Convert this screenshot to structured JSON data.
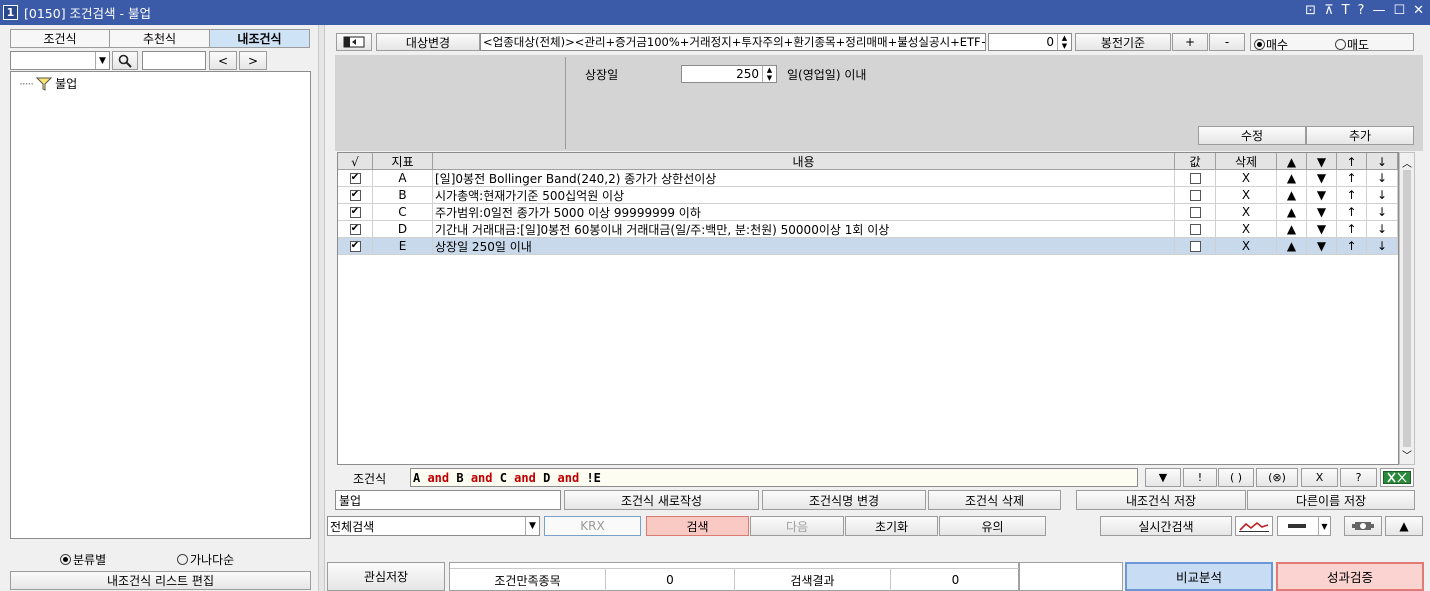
{
  "window": {
    "num": "1",
    "title": "[0150] 조건검색 - 불업",
    "controls": [
      "⊡",
      "⊼",
      "T",
      "?",
      "—",
      "☐",
      "✕"
    ]
  },
  "left": {
    "tabs": [
      "조건식",
      "추천식",
      "내조건식"
    ],
    "prev": "<",
    "next": ">",
    "tree_node": "불업",
    "radio1": "분류별",
    "radio2": "가나다순",
    "edit_list": "내조건식 리스트 편집"
  },
  "top": {
    "target_change": "대상변경",
    "target_text": "<업종대상(전체)><관리+증거금100%+거래정지+투자주의+환기종목+정리매매+불성실공시+ETF+",
    "num_value": "0",
    "bong": "봉전기준",
    "plus": "+",
    "minus": "-",
    "buy": "매수",
    "sell": "매도"
  },
  "cond": {
    "label": "상장일",
    "value": "250",
    "suffix": "일(영업일) 이내",
    "edit": "수정",
    "add": "추가"
  },
  "grid": {
    "headers": [
      "√",
      "지표",
      "내용",
      "값",
      "삭제",
      "▲",
      "▼",
      "↑",
      "↓"
    ],
    "rows": [
      {
        "id": "A",
        "content": "[일]0봉전 Bollinger Band(240,2) 종가가 상한선이상",
        "del": "X",
        "checked": true,
        "val_checked": false
      },
      {
        "id": "B",
        "content": "시가총액:현재가기준 500십억원 이상",
        "del": "X",
        "checked": true,
        "val_checked": false
      },
      {
        "id": "C",
        "content": "주가범위:0일전 종가가 5000 이상 99999999 이하",
        "del": "X",
        "checked": true,
        "val_checked": false
      },
      {
        "id": "D",
        "content": "기간내 거래대금:[일]0봉전 60봉이내 거래대금(일/주:백만, 분:천원) 50000이상 1회 이상",
        "del": "X",
        "checked": true,
        "val_checked": false
      },
      {
        "id": "E",
        "content": "상장일 250일 이내",
        "del": "X",
        "checked": true,
        "val_checked": false,
        "selected": true
      }
    ]
  },
  "formula": {
    "label": "조건식",
    "tokens": [
      {
        "t": "A",
        "k": "v"
      },
      {
        "t": " and ",
        "k": "k"
      },
      {
        "t": "B",
        "k": "v"
      },
      {
        "t": " and ",
        "k": "k"
      },
      {
        "t": "C",
        "k": "v"
      },
      {
        "t": " and ",
        "k": "k"
      },
      {
        "t": "D",
        "k": "v"
      },
      {
        "t": " and ",
        "k": "k"
      },
      {
        "t": "!E",
        "k": "v"
      }
    ],
    "ops": [
      "▼",
      "!",
      "( )",
      "(⊗)",
      "X",
      "?"
    ]
  },
  "actions": {
    "name": "불업",
    "new": "조건식 새로작성",
    "rename": "조건식명 변경",
    "delete": "조건식 삭제",
    "save": "내조건식 저장",
    "save_as": "다른이름 저장"
  },
  "search": {
    "scope": "전체검색",
    "krx": "KRX",
    "search": "검색",
    "next": "다음",
    "reset": "초기화",
    "caution": "유의",
    "realtime": "실시간검색",
    "up": "▲"
  },
  "bottom": {
    "save_interest": "관심저장",
    "cond_count_label": "조건만족종목",
    "cond_count": "0",
    "result_label": "검색결과",
    "result": "0",
    "compare": "비교분석",
    "verify": "성과검증"
  },
  "colors": {
    "title_bar": "#3b5aa8",
    "search_btn": "#f9c9c4",
    "compare_btn": "#c8dcf4",
    "verify_btn": "#fbd3d1",
    "keyword": "#c00000"
  }
}
